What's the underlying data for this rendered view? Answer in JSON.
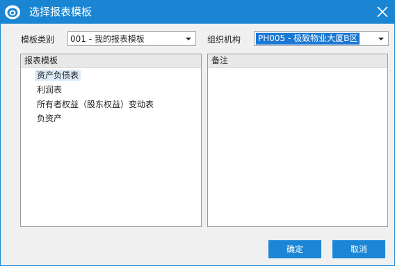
{
  "window": {
    "title": "选择报表模板"
  },
  "filters": {
    "category_label": "模板类别",
    "category_value": "001 - 我的报表模板",
    "org_label": "组织机构",
    "org_value": "PH005 - 极致物业大厦B区"
  },
  "template_panel": {
    "header": "报表模板",
    "items": [
      {
        "label": "资产负债表",
        "selected": true
      },
      {
        "label": "利润表",
        "selected": false
      },
      {
        "label": "所有者权益（股东权益）变动表",
        "selected": false
      },
      {
        "label": "负资产",
        "selected": false
      }
    ]
  },
  "remark_panel": {
    "header": "备注"
  },
  "buttons": {
    "ok": "确定",
    "cancel": "取消"
  },
  "colors": {
    "titlebar": "#1a86d3",
    "button": "#1c86d6",
    "selection": "#1a77d4"
  }
}
